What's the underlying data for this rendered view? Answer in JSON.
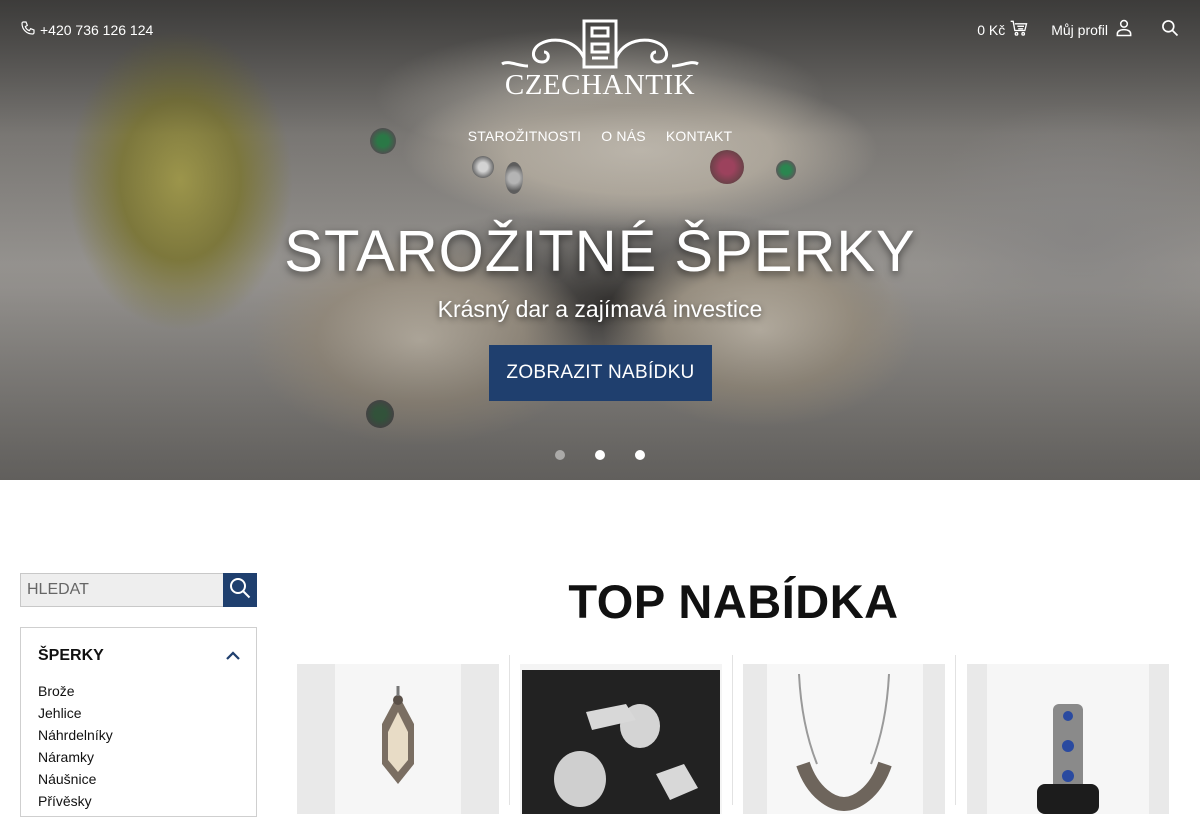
{
  "header": {
    "phone": "+420 736 126 124",
    "cart_total": "0 Kč",
    "profile_label": "Můj profil",
    "logo_text": "CZECHANTIK"
  },
  "nav": {
    "items": [
      "STAROŽITNOSTI",
      "O NÁS",
      "KONTAKT"
    ]
  },
  "hero": {
    "title": "STAROŽITNÉ ŠPERKY",
    "subtitle": "Krásný dar a zajímavá investice",
    "button_label": "ZOBRAZIT NABÍDKU",
    "slide_count": 3,
    "active_slide": 1
  },
  "sidebar": {
    "search_placeholder": "HLEDAT",
    "category_title": "ŠPERKY",
    "categories": [
      "Brože",
      "Jehlice",
      "Náhrdelníky",
      "Náramky",
      "Náušnice",
      "Přívěsky"
    ]
  },
  "main": {
    "section_title": "TOP NABÍDKA"
  },
  "colors": {
    "accent": "#1f3f6e",
    "text": "#111111",
    "border": "#cfcfcf"
  },
  "icons": [
    "phone-icon",
    "cart-icon",
    "user-icon",
    "search-icon",
    "chevron-up-icon"
  ]
}
